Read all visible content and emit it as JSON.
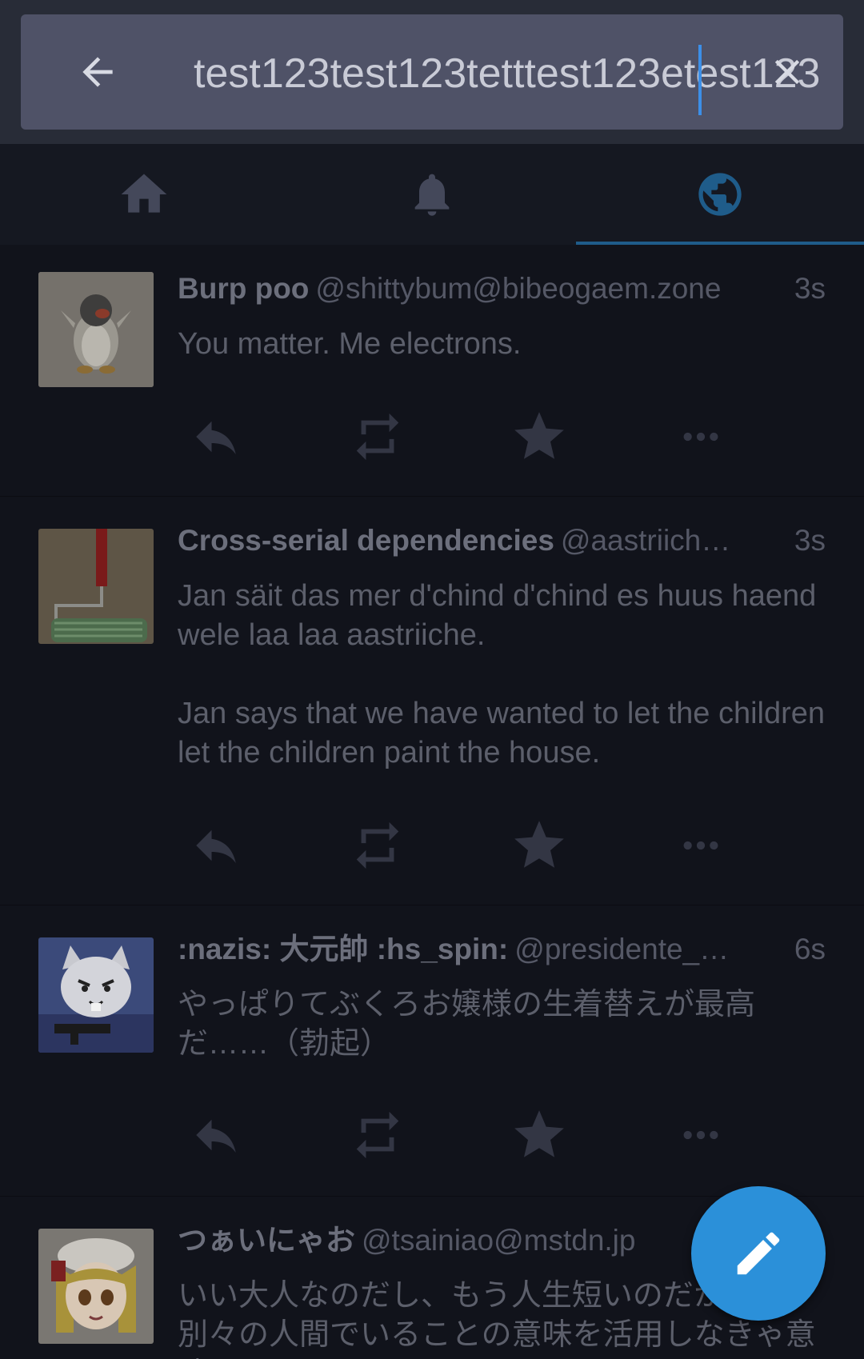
{
  "search": {
    "query": "test123test123tetttest123etest123",
    "placeholder": ""
  },
  "tabs": [
    {
      "icon": "home-icon",
      "active": false
    },
    {
      "icon": "bell-icon",
      "active": false
    },
    {
      "icon": "globe-icon",
      "active": true
    }
  ],
  "colors": {
    "accent": "#2b90d9",
    "search_bg": "#4f5267",
    "feed_bg": "#10121a"
  },
  "statuses": [
    {
      "display_name": "Burp poo",
      "acct": "@shittybum@bibeogaem.zone",
      "time": "3s",
      "content": [
        "You matter. Me electrons."
      ],
      "avatar": "penguin-avatar"
    },
    {
      "display_name": "Cross-serial dependencies",
      "acct": "@aastriich…",
      "time": "3s",
      "content": [
        "Jan säit das mer d'chind d'chind es huus haend wele laa laa aastriiche.",
        "Jan says that we have wanted to let the children let the children paint the house."
      ],
      "avatar": "paint-roller-avatar"
    },
    {
      "display_name": ":nazis: 大元帥 :hs_spin:",
      "acct": "@presidente_…",
      "time": "6s",
      "content": [
        "やっぱりてぶくろお嬢様の生着替えが最高だ……（勃起）"
      ],
      "avatar": "cat-avatar"
    },
    {
      "display_name": "つぁいにゃお",
      "acct": "@tsainiao@mstdn.jp",
      "time": "",
      "content": [
        "いい大人なのだし、もう人生短いのだから、別々の人間でいることの意味を活用しなきゃ意味ないよね"
      ],
      "avatar": "anime-girl-avatar"
    }
  ]
}
